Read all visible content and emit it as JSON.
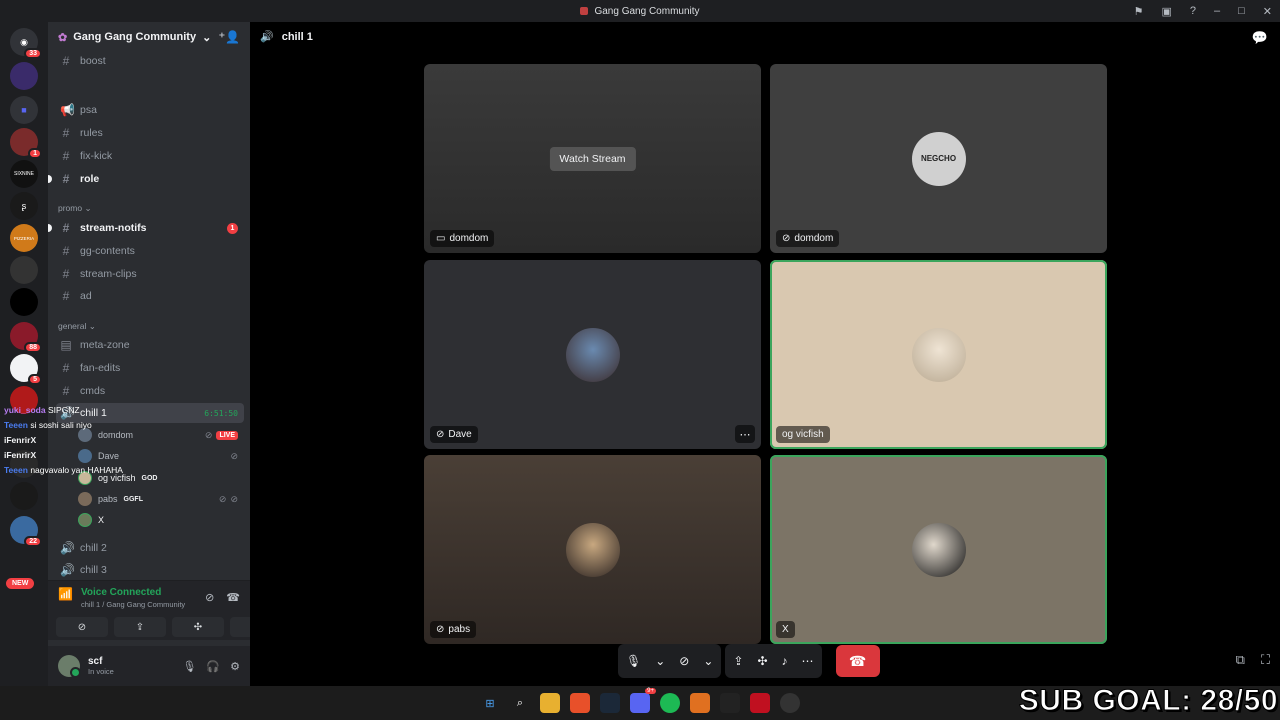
{
  "window": {
    "title": "Gang Gang Community"
  },
  "servers": [
    {
      "label": "33",
      "color": "#5865f2"
    },
    {
      "label": "",
      "color": "#3a2b6a"
    },
    {
      "label": "",
      "color": "#5865f2"
    },
    {
      "label": "1",
      "color": "#7a2b2b"
    },
    {
      "label": "SIXNINE",
      "color": "#111111"
    },
    {
      "label": "",
      "color": "#1a1a1a"
    },
    {
      "label": "PIZZERIA",
      "color": "#d07a1a"
    },
    {
      "label": "",
      "color": "#333333"
    },
    {
      "label": "",
      "color": "#000000"
    },
    {
      "label": "88",
      "color": "#8a1a2a"
    },
    {
      "label": "5",
      "color": "#f2f3f5"
    },
    {
      "label": "",
      "color": "#b01a1a"
    },
    {
      "label": "",
      "color": "#2a2a2a"
    },
    {
      "label": "",
      "color": "#1a1a1a"
    },
    {
      "label": "22",
      "color": "#3a6aa0"
    }
  ],
  "server_new_label": "NEW",
  "guild": {
    "name": "Gang Gang Community"
  },
  "channels": {
    "boost": "boost",
    "psa": "psa",
    "rules": "rules",
    "fix_kick": "fix-kick",
    "role": "role",
    "cat_promo": "promo",
    "stream_notifs": "stream-notifs",
    "stream_notifs_mentions": "1",
    "gg_contents": "gg-contents",
    "stream_clips": "stream-clips",
    "ad": "ad",
    "cat_general": "general",
    "meta_zone": "meta-zone",
    "fan_edits": "fan-edits",
    "cmds": "cmds",
    "chill1": "chill 1",
    "chill1_timer": "6:51:50",
    "chill2": "chill 2",
    "chill3": "chill 3"
  },
  "voice_users": [
    {
      "name": "domdom",
      "badge": "LIVE"
    },
    {
      "name": "Dave",
      "badge": ""
    },
    {
      "name": "og vicfish",
      "badge": "GOD"
    },
    {
      "name": "pabs",
      "badge": "GGFL"
    },
    {
      "name": "X",
      "badge": ""
    }
  ],
  "overlay_chat": [
    {
      "user": "yuki_soda",
      "msg": "SIPGNZ",
      "color": "#b57cf0"
    },
    {
      "user": "Teeen",
      "msg": "si soshi sali niyo",
      "color": "#4a7cf0"
    },
    {
      "user": "iFenrirX",
      "msg": "",
      "color": "#f2f3f5"
    },
    {
      "user": "iFenrirX",
      "msg": "",
      "color": "#f2f3f5"
    },
    {
      "user": "Teeen",
      "msg": "nagvavalo yan HAHAHA",
      "color": "#4a7cf0"
    }
  ],
  "voice_panel": {
    "title": "Voice Connected",
    "sub": "chill 1 / Gang Gang Community"
  },
  "user_panel": {
    "name": "scf",
    "status": "In voice"
  },
  "main": {
    "channel": "chill 1"
  },
  "tiles": [
    {
      "name": "domdom",
      "watch": "Watch Stream"
    },
    {
      "name": "domdom",
      "avatar_text": "NEGCHO"
    },
    {
      "name": "Dave"
    },
    {
      "name": "og vicfish"
    },
    {
      "name": "pabs"
    },
    {
      "name": "X"
    }
  ],
  "stream_overlay": {
    "subgoal": "SUB GOAL: 28/50"
  },
  "taskbar": {
    "discord_badge": "9+"
  },
  "colors": {
    "speaking": "#3ba55c",
    "hangup": "#da373c",
    "mention": "#f23f43",
    "connected": "#23a55a"
  }
}
